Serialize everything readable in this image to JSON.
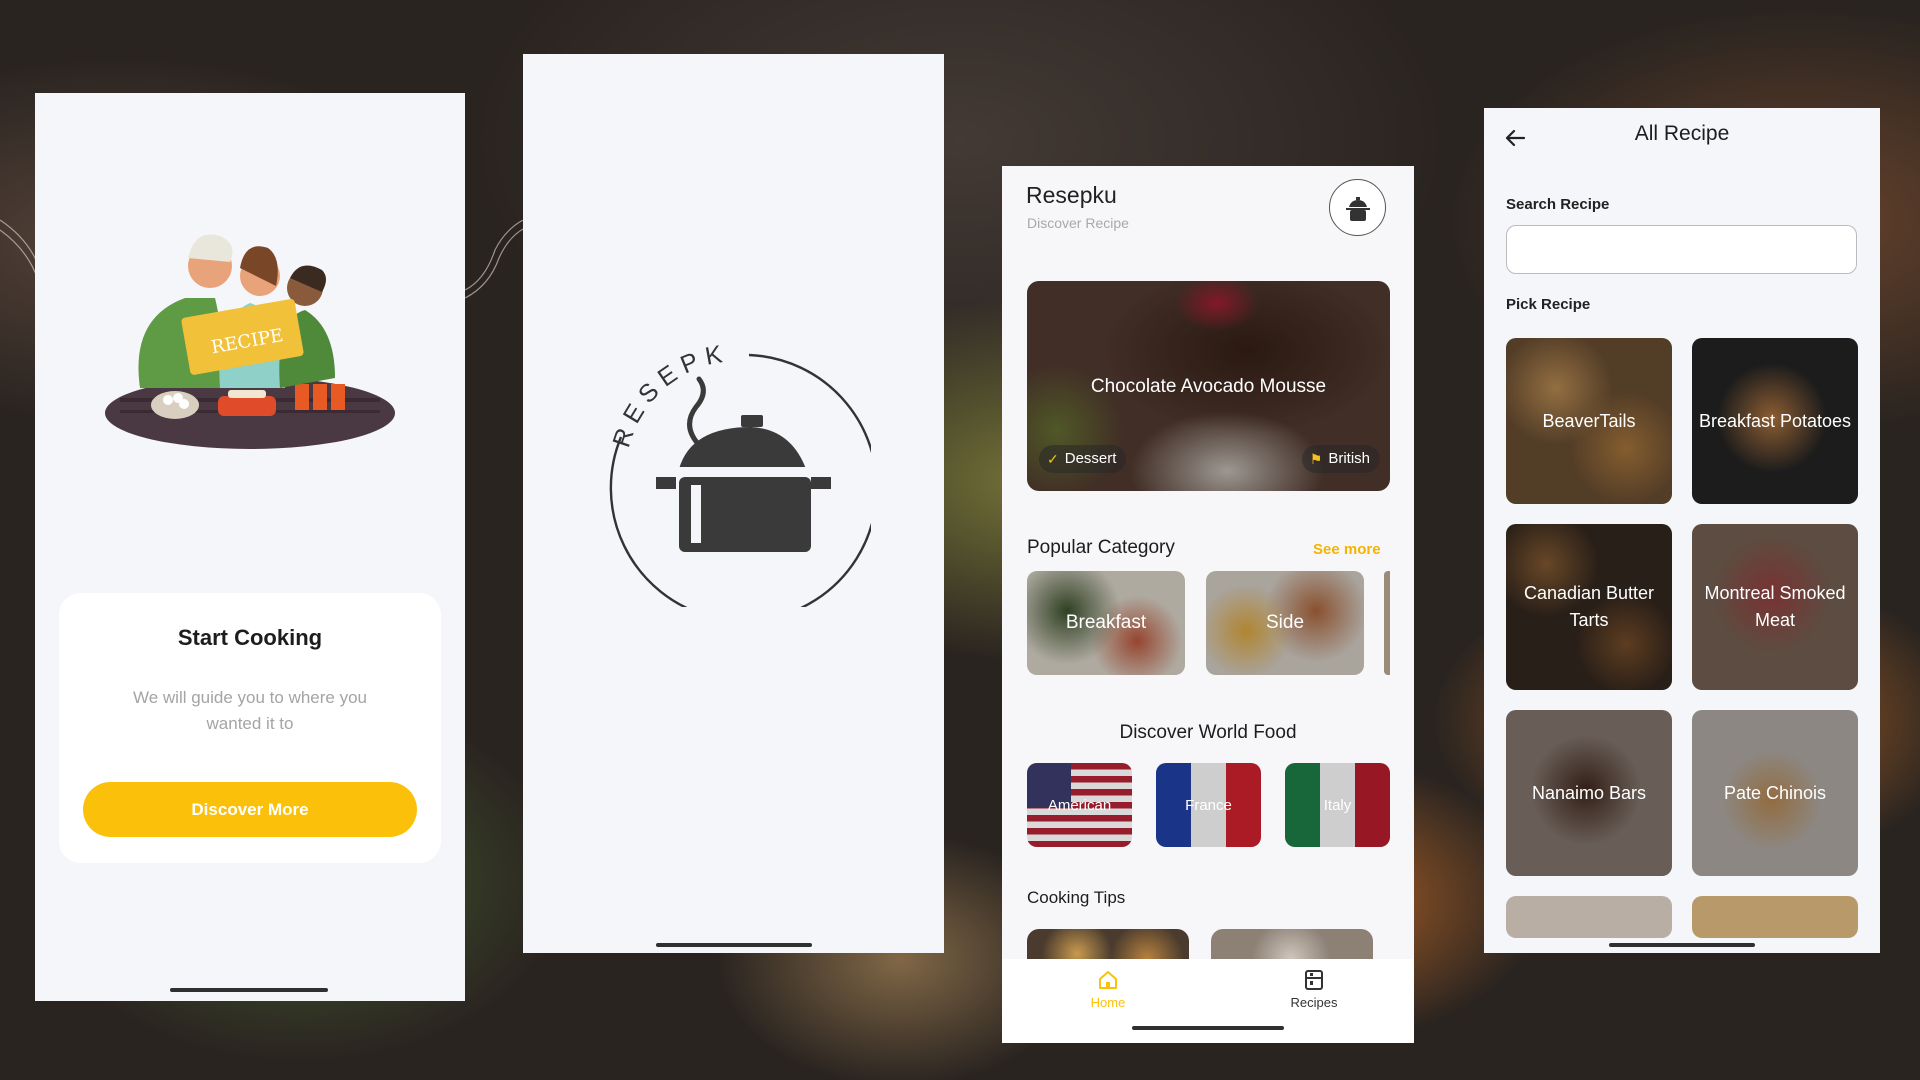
{
  "onboarding": {
    "title": "Start Cooking",
    "description": "We will guide you to where you wanted it to",
    "button_label": "Discover More",
    "illustration_sign": "RECIPE"
  },
  "splash": {
    "logo_text": "RESEPKU"
  },
  "home": {
    "app_title": "Resepku",
    "subtitle": "Discover Recipe",
    "featured": {
      "title": "Chocolate Avocado Mousse",
      "category": "Dessert",
      "area": "British"
    },
    "popular_category_title": "Popular Category",
    "see_more_label": "See more",
    "categories": [
      {
        "label": "Breakfast"
      },
      {
        "label": "Side"
      }
    ],
    "world_food_title": "Discover World Food",
    "world_food": [
      {
        "label": "American"
      },
      {
        "label": "France"
      },
      {
        "label": "Italy"
      }
    ],
    "cooking_tips_title": "Cooking Tips",
    "nav": [
      {
        "label": "Home",
        "icon": "home-icon",
        "active": true
      },
      {
        "label": "Recipes",
        "icon": "recipes-icon",
        "active": false
      }
    ],
    "accent_color": "#FBC10A"
  },
  "all_recipe": {
    "title": "All Recipe",
    "search_label": "Search Recipe",
    "search_placeholder": "",
    "pick_label": "Pick Recipe",
    "recipes": [
      {
        "label": "BeaverTails"
      },
      {
        "label": "Breakfast Potatoes"
      },
      {
        "label": "Canadian Butter Tarts"
      },
      {
        "label": "Montreal Smoked Meat"
      },
      {
        "label": "Nanaimo Bars"
      },
      {
        "label": "Pate Chinois"
      }
    ]
  }
}
